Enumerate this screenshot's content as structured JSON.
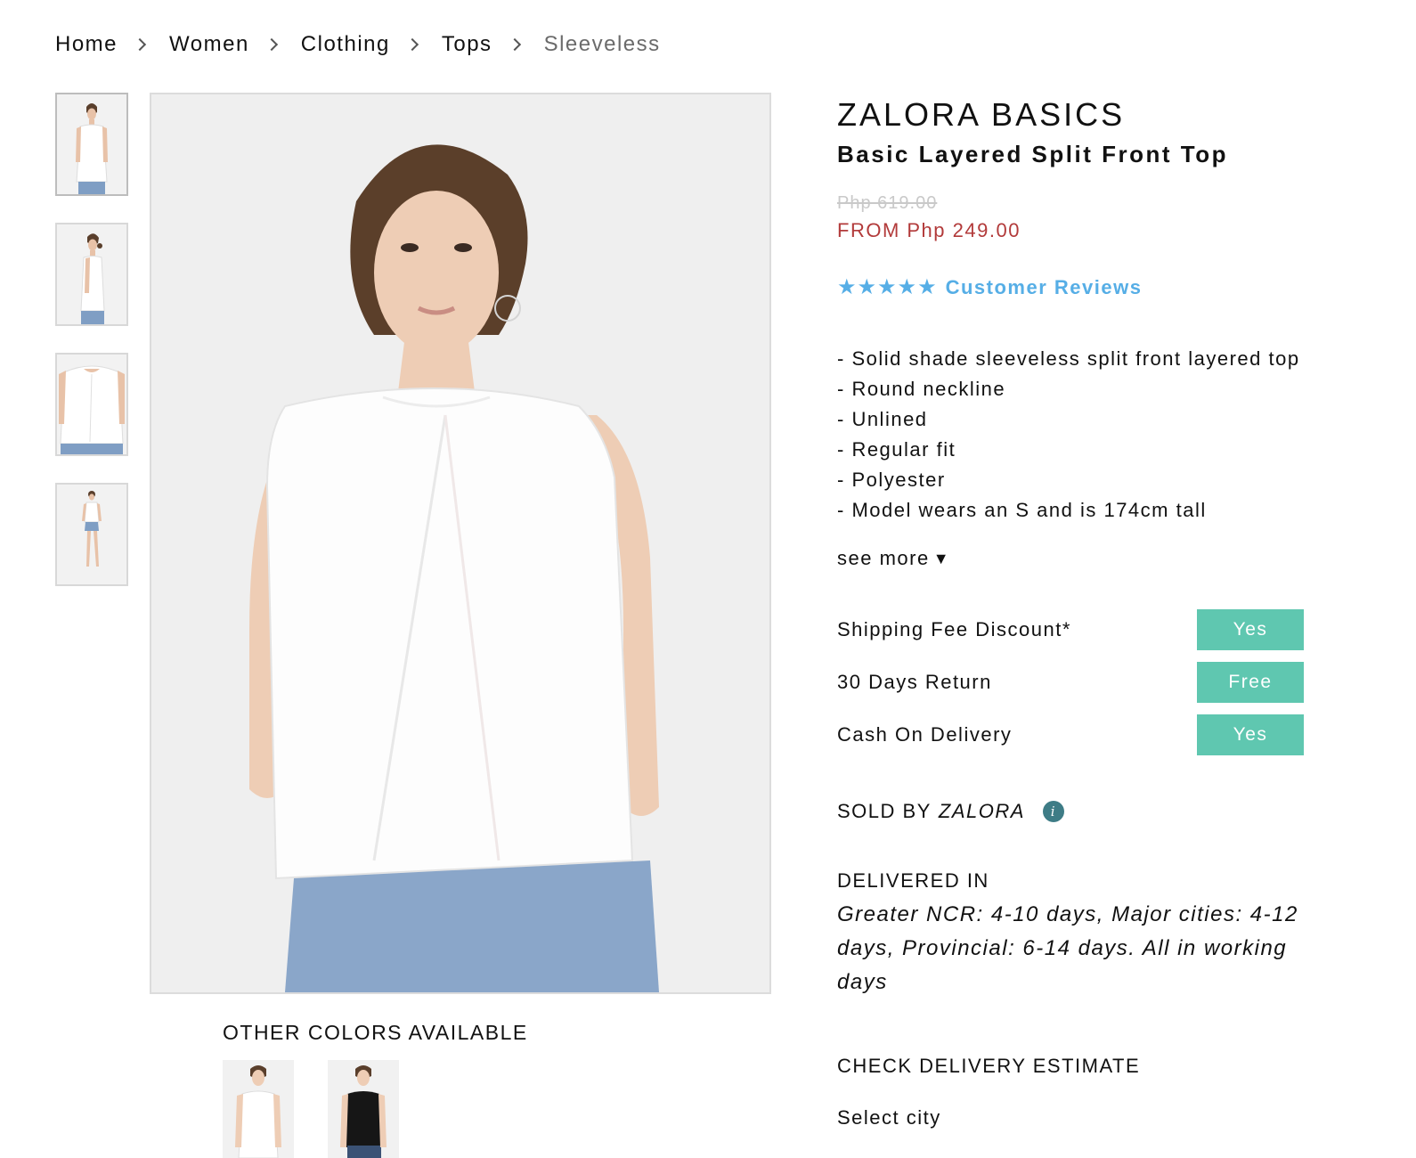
{
  "breadcrumb": {
    "items": [
      "Home",
      "Women",
      "Clothing",
      "Tops"
    ],
    "current": "Sleeveless"
  },
  "gallery": {
    "thumbnails": [
      "front view",
      "side view",
      "detail view",
      "full body view"
    ],
    "active_index": 0
  },
  "other_colors": {
    "title": "OTHER COLORS AVAILABLE",
    "swatches": [
      "white",
      "black"
    ]
  },
  "product": {
    "brand": "ZALORA BASICS",
    "name": "Basic Layered Split Front Top",
    "old_price": "Php 619.00",
    "price": "FROM Php 249.00",
    "rating": 5,
    "reviews_label": "Customer Reviews",
    "description": [
      "- Solid shade sleeveless split front layered top",
      "- Round neckline",
      "- Unlined",
      "- Regular fit",
      "- Polyester",
      "- Model wears an S and is 174cm tall"
    ],
    "see_more": "see more",
    "see_more_icon": "triangle-down-icon"
  },
  "features": [
    {
      "label": "Shipping Fee Discount*",
      "value": "Yes"
    },
    {
      "label": "30 Days Return",
      "value": "Free"
    },
    {
      "label": "Cash On Delivery",
      "value": "Yes"
    }
  ],
  "seller": {
    "label": "SOLD BY",
    "name": "ZALORA",
    "icon": "info-icon"
  },
  "delivery": {
    "title": "DELIVERED IN",
    "text": "Greater NCR: 4-10 days, Major cities: 4-12 days, Provincial: 6-14 days. All in working days",
    "check_title": "CHECK DELIVERY ESTIMATE",
    "select_city": "Select city"
  },
  "colors": {
    "price_red": "#b23a3a",
    "review_blue": "#56aee6",
    "badge_teal": "#5fc7b0",
    "info_icon": "#3e7c86"
  }
}
